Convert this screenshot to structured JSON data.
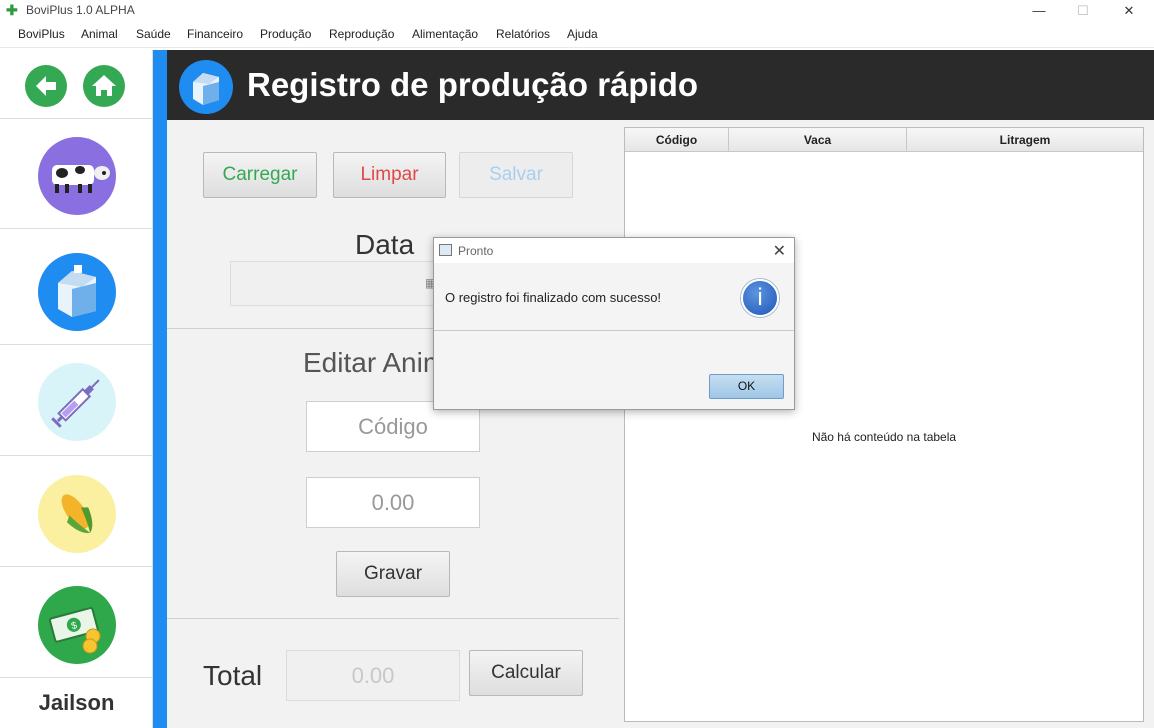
{
  "window": {
    "title": "BoviPlus 1.0 ALPHA",
    "minimize": "—",
    "maximize": "☐",
    "close": "✕"
  },
  "menu": [
    "BoviPlus",
    "Animal",
    "Saúde",
    "Financeiro",
    "Produção",
    "Reprodução",
    "Alimentação",
    "Relatórios",
    "Ajuda"
  ],
  "sidebar": {
    "user": "Jailson",
    "colors": {
      "cow": "#8a6fe0",
      "milk": "#1e8cf0",
      "syringe": "#d8f4f8",
      "corn": "#fbefa0",
      "money": "#2ea84a"
    }
  },
  "header": {
    "title": "Registro de produção rápido"
  },
  "actions": {
    "carregar": "Carregar",
    "limpar": "Limpar",
    "salvar": "Salvar"
  },
  "form": {
    "data_label": "Data",
    "editar_label": "Editar Animal",
    "codigo_placeholder": "Código",
    "valor_placeholder": "0.00",
    "gravar": "Gravar",
    "total_label": "Total",
    "total_value": "0.00",
    "calcular": "Calcular"
  },
  "table": {
    "columns": [
      "Código",
      "Vaca",
      "Litragem"
    ],
    "empty_message": "Não há conteúdo na tabela"
  },
  "dialog": {
    "title": "Pronto",
    "message": "O registro foi finalizado com sucesso!",
    "ok": "OK",
    "close": "✕",
    "info_glyph": "i"
  }
}
